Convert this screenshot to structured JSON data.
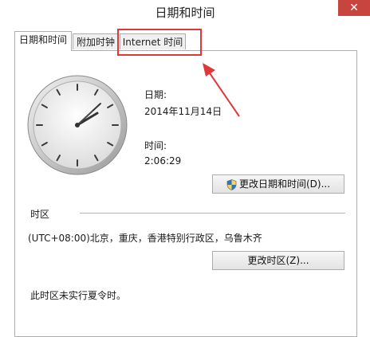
{
  "window": {
    "title": "日期和时间",
    "close_label": "✕"
  },
  "tabs": [
    {
      "label": "日期和时间",
      "active": true
    },
    {
      "label": "附加时钟",
      "active": false
    },
    {
      "label": "Internet 时间",
      "active": false
    }
  ],
  "date_section": {
    "label": "日期:",
    "value": "2014年11月14日"
  },
  "time_section": {
    "label": "时间:",
    "value": "2:06:29"
  },
  "change_datetime_button": "更改日期和时间(D)...",
  "timezone": {
    "heading": "时区",
    "value": "(UTC+08:00)北京，重庆，香港特别行政区，乌鲁木齐",
    "change_button": "更改时区(Z)..."
  },
  "dst_note": "此时区未实行夏令时。",
  "colors": {
    "annotation": "#e0383a",
    "close_button": "#c7453c"
  },
  "icons": {
    "shield": "uac-shield-icon",
    "clock": "analog-clock-icon",
    "arrow": "annotation-arrow-icon"
  }
}
